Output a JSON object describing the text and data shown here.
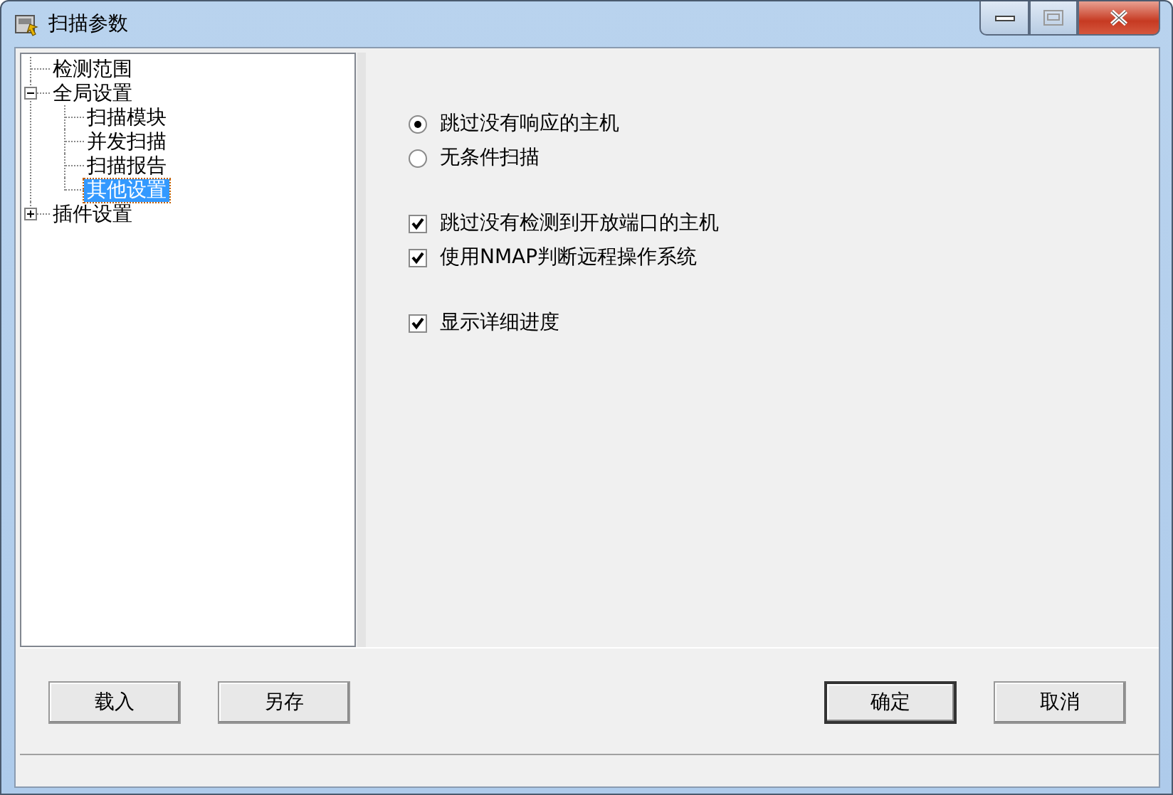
{
  "window": {
    "title": "扫描参数"
  },
  "tree": [
    {
      "label": "检测范围",
      "selected": false
    },
    {
      "label": "全局设置",
      "selected": false,
      "expanded": true,
      "children": [
        {
          "label": "扫描模块",
          "selected": false
        },
        {
          "label": "并发扫描",
          "selected": false
        },
        {
          "label": "扫描报告",
          "selected": false
        },
        {
          "label": "其他设置",
          "selected": true
        }
      ]
    },
    {
      "label": "插件设置",
      "selected": false,
      "expanded": false
    }
  ],
  "option_groups": [
    [
      {
        "kind": "radio",
        "label": "跳过没有响应的主机",
        "selected": true
      },
      {
        "kind": "radio",
        "label": "无条件扫描",
        "selected": false
      }
    ],
    [
      {
        "kind": "checkbox",
        "label": "跳过没有检测到开放端口的主机",
        "checked": true
      },
      {
        "kind": "checkbox",
        "label": "使用NMAP判断远程操作系统",
        "checked": true
      }
    ],
    [
      {
        "kind": "checkbox",
        "label": "显示详细进度",
        "checked": true
      }
    ]
  ],
  "buttons_left": [
    {
      "label": "载入",
      "default": false
    },
    {
      "label": "另存",
      "default": false
    }
  ],
  "buttons_right": [
    {
      "label": "确定",
      "default": true
    },
    {
      "label": "取消",
      "default": false
    }
  ]
}
